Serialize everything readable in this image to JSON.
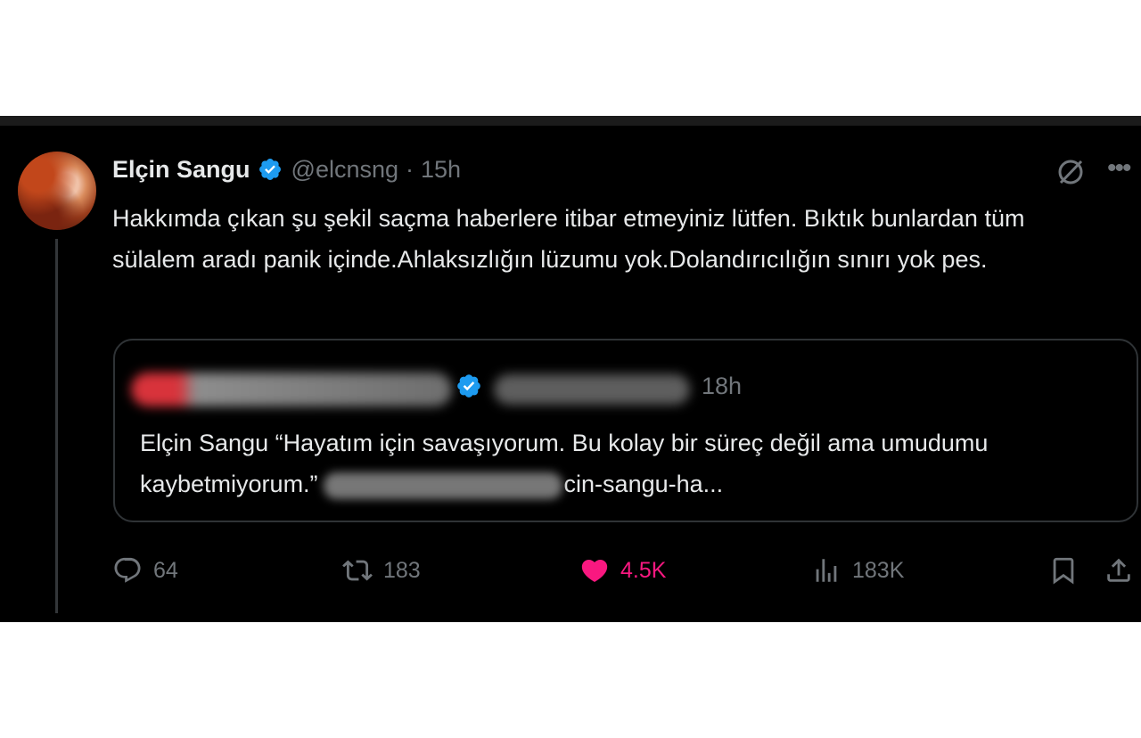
{
  "tweet": {
    "author": {
      "name": "Elçin Sangu",
      "handle": "@elcnsng",
      "time": "15h"
    },
    "text": "Hakkımda çıkan şu şekil saçma haberlere itibar etmeyiniz lütfen. Bıktık bunlardan tüm sülalem aradı panik içinde.Ahlaksızlığın lüzumu yok.Dolandırıcılığın sınırı yok pes.",
    "quote": {
      "time": "18h",
      "text_before": "Elçin Sangu “Hayatım için savaşıyorum. Bu kolay bir süreç değil ama umudumu kaybetmiyorum.”",
      "text_after": "cin-sangu-ha..."
    },
    "actions": {
      "replies": "64",
      "reposts": "183",
      "likes": "4.5K",
      "views": "183K"
    },
    "icons": [
      "verified-badge-icon",
      "grok-icon",
      "more-icon",
      "reply-icon",
      "repost-icon",
      "like-icon",
      "views-icon",
      "bookmark-icon",
      "share-icon"
    ],
    "colors": {
      "background": "#000000",
      "text": "#e7e9ea",
      "muted": "#71767b",
      "verified": "#1d9bf0",
      "like": "#f91880"
    }
  }
}
